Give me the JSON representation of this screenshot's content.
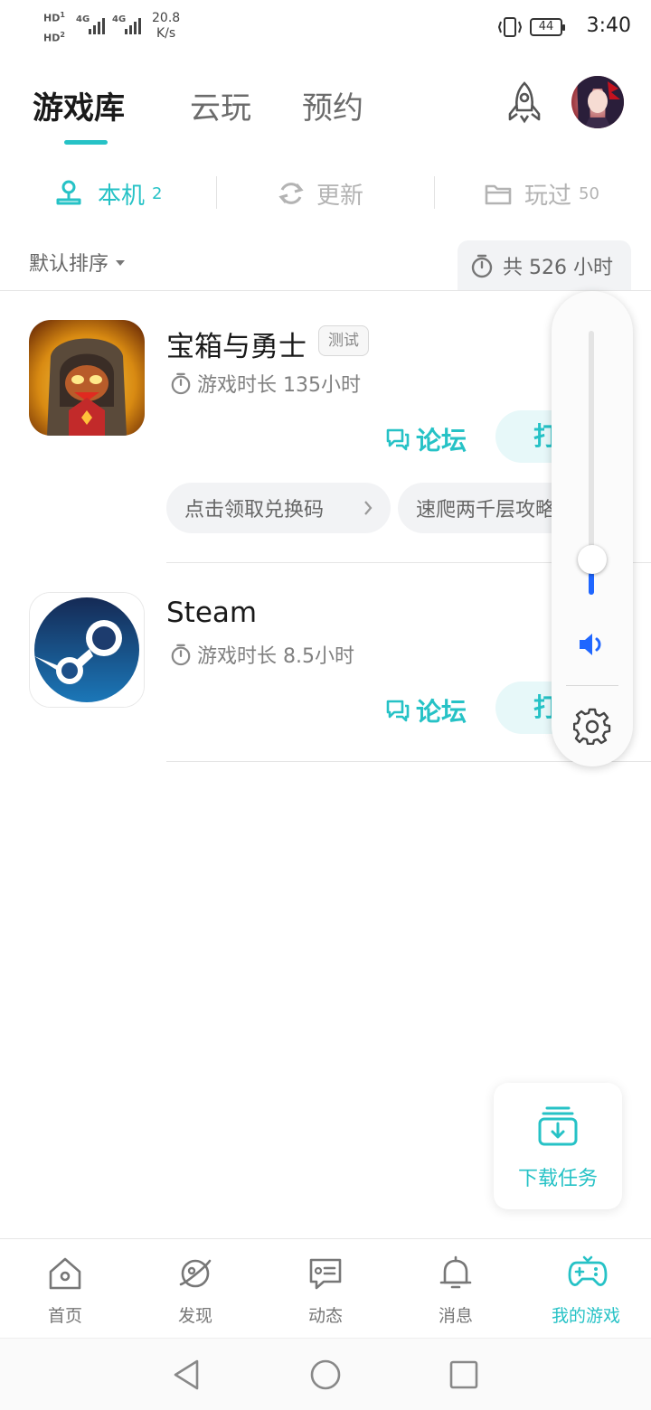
{
  "status_bar": {
    "sim1": "HD",
    "sim1_index": "1",
    "sim2": "HD",
    "sim2_index": "2",
    "network1": "4G",
    "network2": "4G",
    "speed_value": "20.8",
    "speed_unit": "K/s",
    "battery": "44",
    "time": "3:40"
  },
  "header": {
    "tabs": [
      {
        "label": "游戏库",
        "active": true
      },
      {
        "label": "云玩",
        "active": false
      },
      {
        "label": "预约",
        "active": false
      }
    ]
  },
  "filters": [
    {
      "label": "本机",
      "count": "2",
      "icon": "location-pin-icon",
      "active": true
    },
    {
      "label": "更新",
      "count": "",
      "icon": "refresh-icon",
      "active": false
    },
    {
      "label": "玩过",
      "count": "50",
      "icon": "folder-icon",
      "active": false
    }
  ],
  "sort": {
    "label": "默认排序"
  },
  "total_playtime": {
    "label": "共 526 小时"
  },
  "games": [
    {
      "name": "宝箱与勇士",
      "tag": "测试",
      "playtime": "游戏时长 135小时",
      "forum_label": "论坛",
      "open_label": "打开",
      "chips": [
        "点击领取兑换码",
        "速爬两千层攻略"
      ]
    },
    {
      "name": "Steam",
      "playtime": "游戏时长 8.5小时",
      "forum_label": "论坛",
      "open_label": "打开"
    }
  ],
  "volume_panel": {
    "level": 0.05,
    "speaker_icon": "speaker-icon",
    "settings_icon": "gear-icon"
  },
  "download_task": {
    "label": "下载任务"
  },
  "bottom_nav": [
    {
      "label": "首页",
      "icon": "home-icon",
      "active": false
    },
    {
      "label": "发现",
      "icon": "planet-icon",
      "active": false
    },
    {
      "label": "动态",
      "icon": "message-card-icon",
      "active": false
    },
    {
      "label": "消息",
      "icon": "bell-icon",
      "active": false
    },
    {
      "label": "我的游戏",
      "icon": "gamepad-icon",
      "active": true
    }
  ],
  "colors": {
    "accent": "#26c2c6",
    "volume_blue": "#1f66ff"
  }
}
